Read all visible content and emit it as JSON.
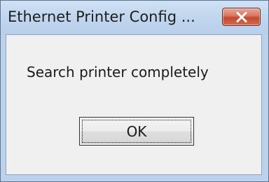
{
  "window": {
    "title": "Ethernet Printer Config ...",
    "close_icon": "close-icon",
    "close_button_color": "#c44a30"
  },
  "dialog": {
    "message": "Search printer completely",
    "ok_label": "OK"
  }
}
